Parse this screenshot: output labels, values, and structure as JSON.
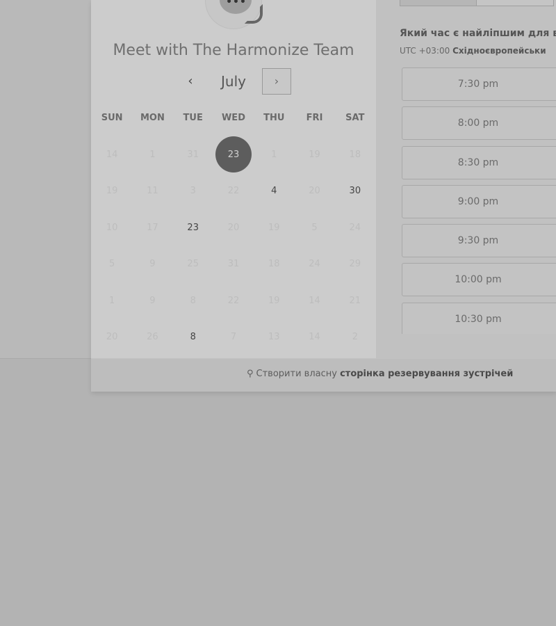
{
  "calendar": {
    "title": "Meet with The Harmonize Team",
    "month": "July",
    "prev_label": "‹",
    "next_label": "›",
    "weekdays": [
      "SUN",
      "MON",
      "TUE",
      "WED",
      "THU",
      "FRI",
      "SAT"
    ],
    "weeks": [
      [
        {
          "d": "14",
          "s": "faded"
        },
        {
          "d": "1",
          "s": "faded"
        },
        {
          "d": "31",
          "s": "faded"
        },
        {
          "d": "23",
          "s": "selected"
        },
        {
          "d": "1",
          "s": "faded"
        },
        {
          "d": "19",
          "s": "faded"
        },
        {
          "d": "18",
          "s": "faded"
        }
      ],
      [
        {
          "d": "19",
          "s": "faded"
        },
        {
          "d": "11",
          "s": "faded"
        },
        {
          "d": "3",
          "s": "faded"
        },
        {
          "d": "22",
          "s": "faded"
        },
        {
          "d": "4",
          "s": "avail"
        },
        {
          "d": "20",
          "s": "faded"
        },
        {
          "d": "30",
          "s": "avail"
        }
      ],
      [
        {
          "d": "10",
          "s": "faded"
        },
        {
          "d": "17",
          "s": "faded"
        },
        {
          "d": "23",
          "s": "avail"
        },
        {
          "d": "20",
          "s": "faded"
        },
        {
          "d": "19",
          "s": "faded"
        },
        {
          "d": "5",
          "s": "faded"
        },
        {
          "d": "24",
          "s": "faded"
        }
      ],
      [
        {
          "d": "5",
          "s": "faded"
        },
        {
          "d": "9",
          "s": "faded"
        },
        {
          "d": "25",
          "s": "faded"
        },
        {
          "d": "31",
          "s": "faded"
        },
        {
          "d": "18",
          "s": "faded"
        },
        {
          "d": "24",
          "s": "faded"
        },
        {
          "d": "29",
          "s": "faded"
        }
      ],
      [
        {
          "d": "1",
          "s": "faded"
        },
        {
          "d": "9",
          "s": "faded"
        },
        {
          "d": "8",
          "s": "faded"
        },
        {
          "d": "22",
          "s": "faded"
        },
        {
          "d": "19",
          "s": "faded"
        },
        {
          "d": "14",
          "s": "faded"
        },
        {
          "d": "21",
          "s": "faded"
        }
      ],
      [
        {
          "d": "20",
          "s": "faded"
        },
        {
          "d": "26",
          "s": "faded"
        },
        {
          "d": "8",
          "s": "avail"
        },
        {
          "d": "7",
          "s": "faded"
        },
        {
          "d": "13",
          "s": "faded"
        },
        {
          "d": "14",
          "s": "faded"
        },
        {
          "d": "2",
          "s": "faded"
        }
      ]
    ]
  },
  "times": {
    "question": "Який час є найліпшим для в",
    "timezone_offset": "UTC +03:00",
    "timezone_name": "Східноєвропейськи",
    "slots": [
      "7:30 pm",
      "8:00 pm",
      "8:30 pm",
      "9:00 pm",
      "9:30 pm",
      "10:00 pm",
      "10:30 pm"
    ]
  },
  "footer": {
    "prefix": "Створити власну",
    "link": "сторінка резервування зустрічей"
  },
  "colors": {
    "selected_day": "#5d5d5d",
    "overlay_bg": "#b3b3b3"
  },
  "icons": {
    "avatar": "chat-bubble-icon",
    "footer": "sprocket-icon"
  }
}
